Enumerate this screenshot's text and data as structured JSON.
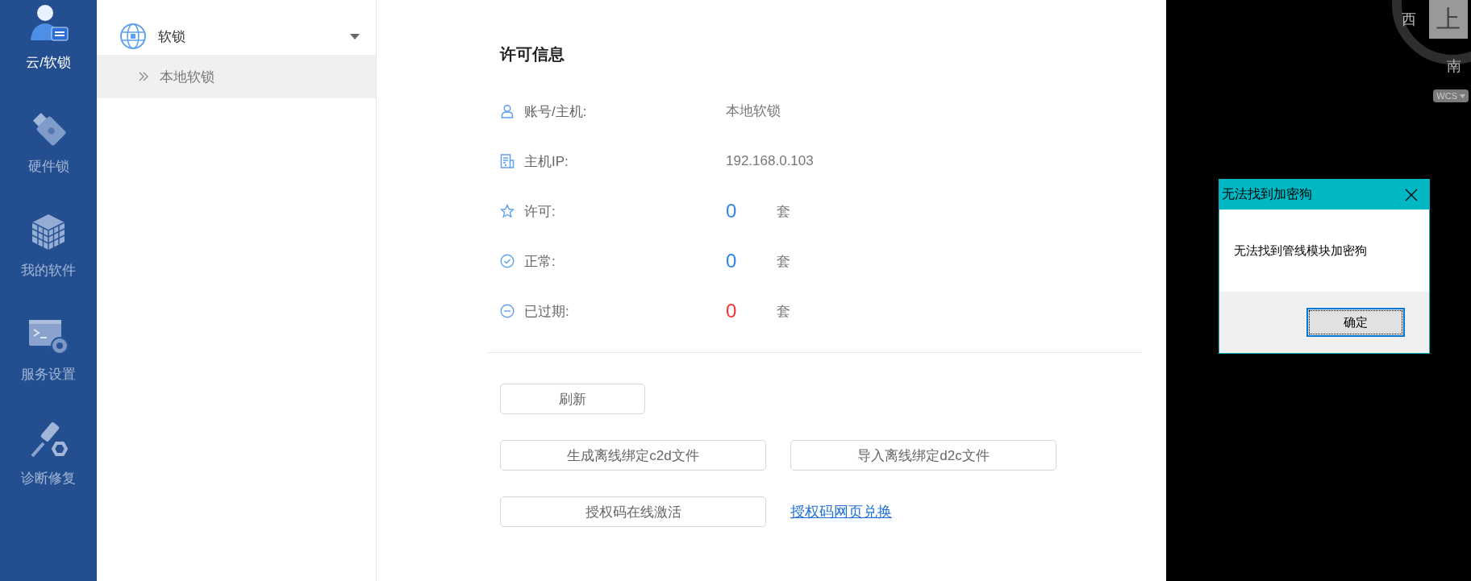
{
  "sidebar": {
    "items": [
      {
        "label": "云/软锁",
        "kind": "user",
        "selected": true
      },
      {
        "label": "硬件锁",
        "kind": "usb",
        "selected": false
      },
      {
        "label": "我的软件",
        "kind": "cube",
        "selected": false
      },
      {
        "label": "服务设置",
        "kind": "service",
        "selected": false
      },
      {
        "label": "诊断修复",
        "kind": "repair",
        "selected": false
      }
    ]
  },
  "tree": {
    "group": {
      "label": "软锁",
      "expanded": true,
      "children": [
        {
          "label": "本地软锁",
          "selected": true
        }
      ]
    }
  },
  "license_info": {
    "title": "许可信息",
    "rows": [
      {
        "kind": "text",
        "label": "账号/主机:",
        "value": "本地软锁"
      },
      {
        "kind": "text",
        "label": "主机IP:",
        "value": "192.168.0.103"
      },
      {
        "kind": "count",
        "label": "许可:",
        "value": "0",
        "unit": "套",
        "color": "#2f86e6"
      },
      {
        "kind": "count",
        "label": "正常:",
        "value": "0",
        "unit": "套",
        "color": "#2f86e6"
      },
      {
        "kind": "count",
        "label": "已过期:",
        "value": "0",
        "unit": "套",
        "color": "#f5322d"
      }
    ]
  },
  "actions": [
    [
      {
        "kind": "button",
        "label": "刷新"
      }
    ],
    [
      {
        "kind": "button",
        "label": "生成离线绑定c2d文件"
      },
      {
        "kind": "button",
        "label": "导入离线绑定d2c文件"
      }
    ],
    [
      {
        "kind": "button",
        "label": "授权码在线激活"
      },
      {
        "kind": "link",
        "label": "授权码网页兑换"
      }
    ]
  ],
  "viewport": {
    "compass": {
      "west": "西",
      "top": "上",
      "south": "南",
      "ucs": "WCS"
    }
  },
  "dialog": {
    "title": "无法找到加密狗",
    "message": "无法找到管线模块加密狗",
    "ok_button": "确定"
  }
}
